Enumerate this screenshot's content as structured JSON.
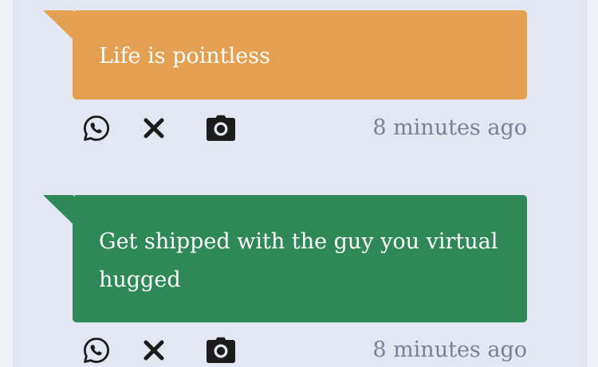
{
  "colors": {
    "page_background": "#eef1f8",
    "panel_background": "#e2e7f1",
    "timestamp_text": "#7a8196",
    "icon": "#1c1c1c"
  },
  "posts": [
    {
      "text": "Life is pointless",
      "color": "#e3a050",
      "actions": [
        "whatsapp-icon",
        "close-icon",
        "camera-icon"
      ],
      "timestamp": "8 minutes ago"
    },
    {
      "text": "Get shipped with the guy you virtual hugged",
      "color": "#2e8858",
      "actions": [
        "whatsapp-icon",
        "close-icon",
        "camera-icon"
      ],
      "timestamp": "8 minutes ago"
    }
  ]
}
